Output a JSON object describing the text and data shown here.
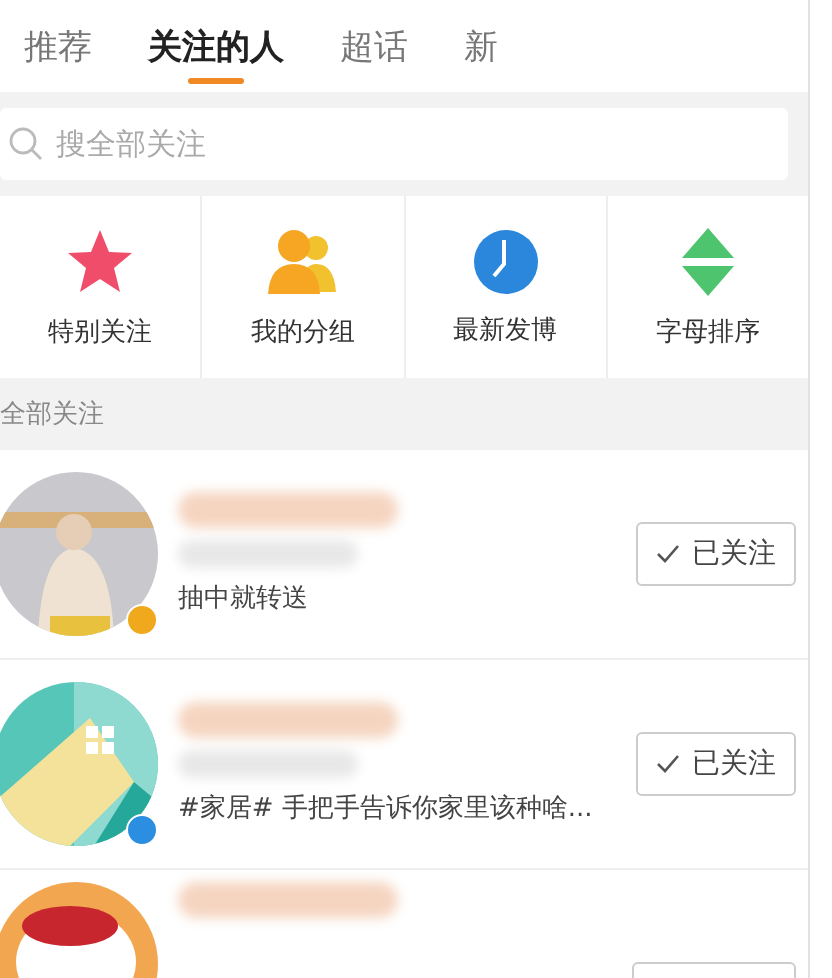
{
  "tabs": [
    {
      "label": "推荐",
      "selected": false
    },
    {
      "label": "关注的人",
      "selected": true
    },
    {
      "label": "超话",
      "selected": false
    },
    {
      "label": "新",
      "selected": false
    }
  ],
  "search": {
    "placeholder": "搜全部关注"
  },
  "shortcuts": [
    {
      "label": "特别关注",
      "kind": "star"
    },
    {
      "label": "我的分组",
      "kind": "group"
    },
    {
      "label": "最新发博",
      "kind": "clock"
    },
    {
      "label": "字母排序",
      "kind": "sort"
    }
  ],
  "section_title": "全部关注",
  "follows": [
    {
      "bio": "抽中就转送",
      "color": "#f0a81c",
      "button": "已关注"
    },
    {
      "bio": "#家居# 手把手告诉你家里该种啥...",
      "color": "#2b8ee0",
      "button": "已关注"
    }
  ]
}
